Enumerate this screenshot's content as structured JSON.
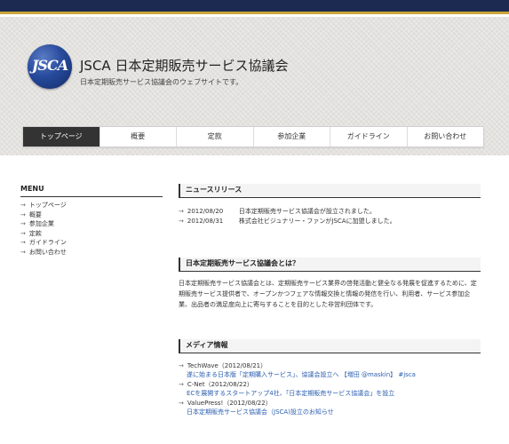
{
  "header": {
    "logo_text": "JSCA",
    "title": "JSCA 日本定期販売サービス協議会",
    "description": "日本定期販売サービス協議会のウェブサイトです。"
  },
  "nav": [
    {
      "label": "トップページ",
      "active": true
    },
    {
      "label": "概要"
    },
    {
      "label": "定款"
    },
    {
      "label": "参加企業"
    },
    {
      "label": "ガイドライン"
    },
    {
      "label": "お問い合わせ"
    }
  ],
  "sidebar": {
    "heading": "MENU",
    "items": [
      "トップページ",
      "概要",
      "参加企業",
      "定款",
      "ガイドライン",
      "お問い合わせ"
    ]
  },
  "news": {
    "heading": "ニュースリリース",
    "items": [
      {
        "date": "2012/08/20",
        "text": "日本定期販売サービス協議会が設立されました。"
      },
      {
        "date": "2012/08/31",
        "text": "株式会社ビジュナリー・ファンがJSCAに加盟しました。"
      }
    ]
  },
  "about": {
    "heading": "日本定期販売サービス協議会とは？",
    "text": "日本定期販売サービス協議会とは、定期販売サービス業界の啓発活動と健全なる発展を促進するために、定期販売サービス提供者で、オープンかつフェアな情報交換と情報の発信を行い、利用者、サービス参加企業、出品者の満足度向上に寄与することを目的とした非営利団体です。"
  },
  "media": {
    "heading": "メディア情報",
    "items": [
      {
        "source": "TechWave（2012/08/21）",
        "link": "遂に始まる日本版「定期購入サービス」、協議会設立へ 【増田 @maskin】 #jsca"
      },
      {
        "source": "C-Net（2012/08/22）",
        "link": "ECを展開するスタートアップ4社、「日本定期販売サービス協議会」を設立"
      },
      {
        "source": "ValuePress!（2012/08/22）",
        "link": "日本定期販売サービス協議会（JSCA)設立のお知らせ"
      }
    ]
  },
  "bullet": "→",
  "colors": {
    "topbar": "#1c2a52",
    "accent_line": "#c9a63a",
    "nav_active": "#333333",
    "link": "#2a5db0"
  }
}
